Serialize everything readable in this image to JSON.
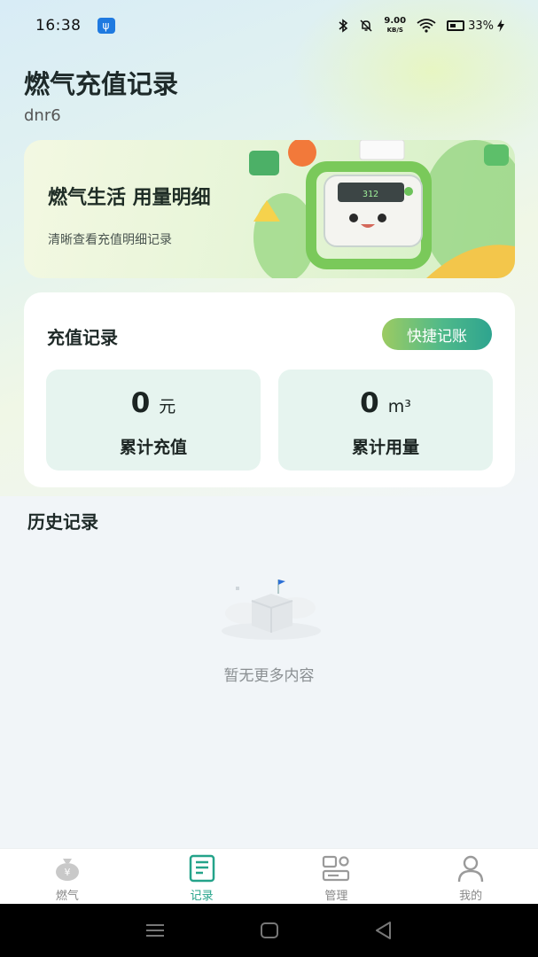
{
  "status_bar": {
    "time": "16:38",
    "net_speed": "9.00",
    "net_unit": "KB/S",
    "battery": "33%"
  },
  "header": {
    "title": "燃气充值记录",
    "user": "dnr6"
  },
  "banner": {
    "title": "燃气生活 用量明细",
    "subtitle": "清晰查看充值明细记录",
    "meter_reading": "312"
  },
  "records_card": {
    "title": "充值记录",
    "quick_button": "快捷记账",
    "stats": [
      {
        "value": "0",
        "unit": "元",
        "label": "累计充值"
      },
      {
        "value": "0",
        "unit": "m³",
        "label": "累计用量"
      }
    ]
  },
  "history": {
    "title": "历史记录",
    "empty_text": "暂无更多内容"
  },
  "tabbar": {
    "tabs": [
      {
        "label": "燃气",
        "icon": "money-bag-icon",
        "active": false
      },
      {
        "label": "记录",
        "icon": "receipt-icon",
        "active": true
      },
      {
        "label": "管理",
        "icon": "manage-icon",
        "active": false
      },
      {
        "label": "我的",
        "icon": "user-icon",
        "active": false
      }
    ],
    "active_color": "#24a38a",
    "inactive_color": "#9a9a9a"
  },
  "colors": {
    "accent": "#2ea48f",
    "stat_bg": "#e6f4ef"
  }
}
